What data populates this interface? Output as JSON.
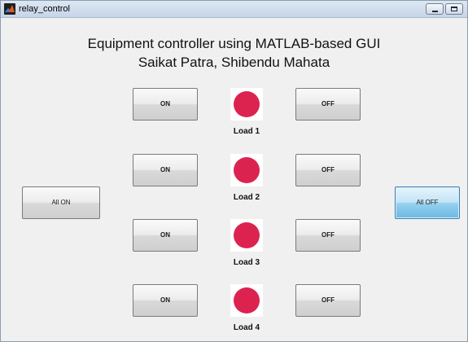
{
  "window": {
    "title": "relay_control"
  },
  "heading": {
    "line1": "Equipment controller using MATLAB-based GUI",
    "line2": "Saikat Patra, Shibendu Mahata"
  },
  "loads": [
    {
      "on_label": "ON",
      "off_label": "OFF",
      "label": "Load 1",
      "lamp_color": "#dc2350"
    },
    {
      "on_label": "ON",
      "off_label": "OFF",
      "label": "Load 2",
      "lamp_color": "#dc2350"
    },
    {
      "on_label": "ON",
      "off_label": "OFF",
      "label": "Load 3",
      "lamp_color": "#dc2350"
    },
    {
      "on_label": "ON",
      "off_label": "OFF",
      "label": "Load 4",
      "lamp_color": "#dc2350"
    }
  ],
  "all_on_label": "All ON",
  "all_off_label": "All OFF",
  "colors": {
    "lamp_off": "#dc2350",
    "focused_button": "#98d1ef"
  },
  "icons": {
    "app": "matlab-logo-icon",
    "minimize": "minimize-icon",
    "maximize": "maximize-icon"
  }
}
